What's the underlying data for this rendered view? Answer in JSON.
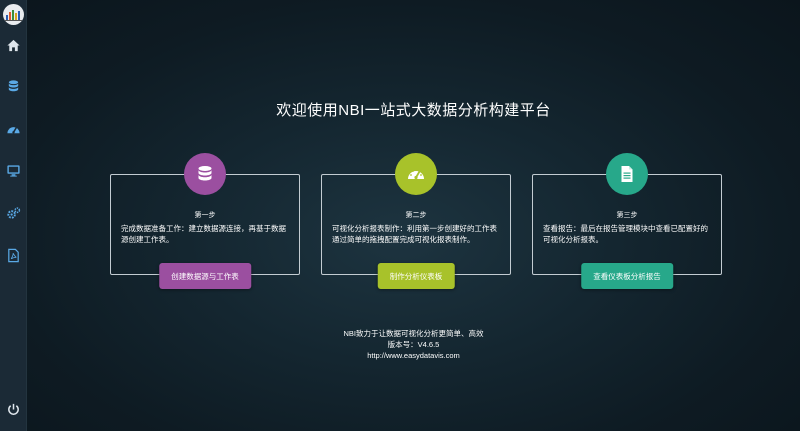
{
  "sidebar": {
    "logo": "nbi-logo",
    "items": [
      {
        "icon": "home-icon"
      },
      {
        "icon": "database-icon"
      },
      {
        "icon": "dashboard-gauge-icon"
      },
      {
        "icon": "monitor-icon"
      },
      {
        "icon": "settings-cogs-icon"
      },
      {
        "icon": "pdf-document-icon"
      }
    ],
    "bottom_icon": "power-icon"
  },
  "main": {
    "title": "欢迎使用NBI一站式大数据分析构建平台",
    "cards": [
      {
        "icon": "database-icon",
        "color": "#9b4fa0",
        "step": "第一步",
        "description": "完成数据准备工作：建立数据源连接，再基于数据源创建工作表。",
        "button": "创建数据源与工作表"
      },
      {
        "icon": "dashboard-gauge-icon",
        "color": "#a8c22a",
        "step": "第二步",
        "description": "可视化分析报表制作：利用第一步创建好的工作表通过简单的拖拽配置完成可视化报表制作。",
        "button": "制作分析仪表板"
      },
      {
        "icon": "report-file-icon",
        "color": "#27a88a",
        "step": "第三步",
        "description": "查看报告：最后在报告管理模块中查看已配置好的可视化分析报表。",
        "button": "查看仪表板分析报告"
      }
    ],
    "footer": {
      "line1": "NBI致力于让数据可视化分析更简单、高效",
      "line2": "版本号：V4.6.5",
      "line3": "http://www.easydatavis.com"
    }
  }
}
